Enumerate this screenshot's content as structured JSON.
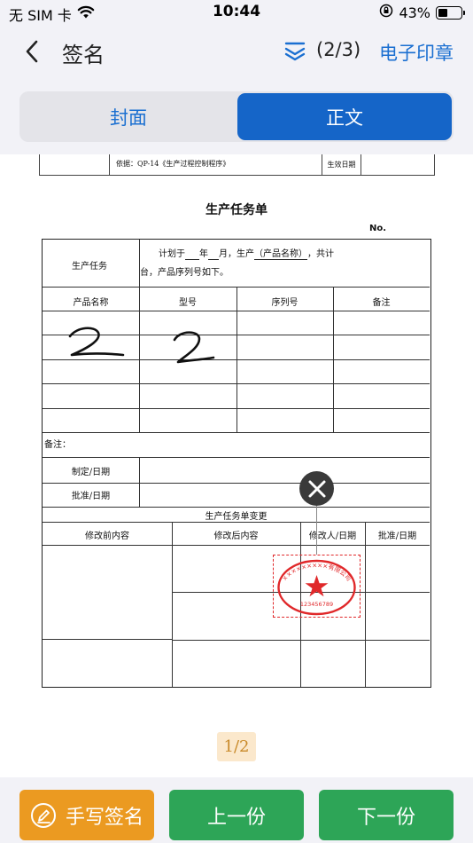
{
  "status_bar": {
    "carrier": "无 SIM 卡",
    "time": "10:44",
    "battery_percent": "43%",
    "battery_level": 0.43
  },
  "nav": {
    "title": "签名",
    "page_count": "(2/3)",
    "stamp_link": "电子印章"
  },
  "segment": {
    "tabs": [
      {
        "label": "封面",
        "selected": false
      },
      {
        "label": "正文",
        "selected": true
      }
    ]
  },
  "document": {
    "header_basis": "依据：QP-14《生产过程控制程序》",
    "header_effective": "生效日期",
    "title": "生产任务单",
    "no_label": "No.",
    "task_label": "生产任务",
    "task_line1_a": "计划于",
    "task_line1_b": "年",
    "task_line1_c": "月，生产",
    "task_line1_d": "（产品名称）",
    "task_line1_e": "，共计",
    "task_line2": "台，产品序列号如下。",
    "columns": [
      "产品名称",
      "型号",
      "序列号",
      "备注"
    ],
    "handwriting": [
      "2",
      "2"
    ],
    "remarks_label": "备注：",
    "made_label": "制定/日期",
    "approved_label": "批准/日期",
    "change_title": "生产任务单变更",
    "change_columns": [
      "修改前内容",
      "修改后内容",
      "修改人/日期",
      "批准/日期"
    ]
  },
  "stamp": {
    "ring_text": "×××××××××有限公司",
    "number": "123456789",
    "color": "#e0282a"
  },
  "pager": {
    "label": "1/2"
  },
  "bottom": {
    "sign_label": "手写签名",
    "prev_label": "上一份",
    "next_label": "下一份"
  }
}
